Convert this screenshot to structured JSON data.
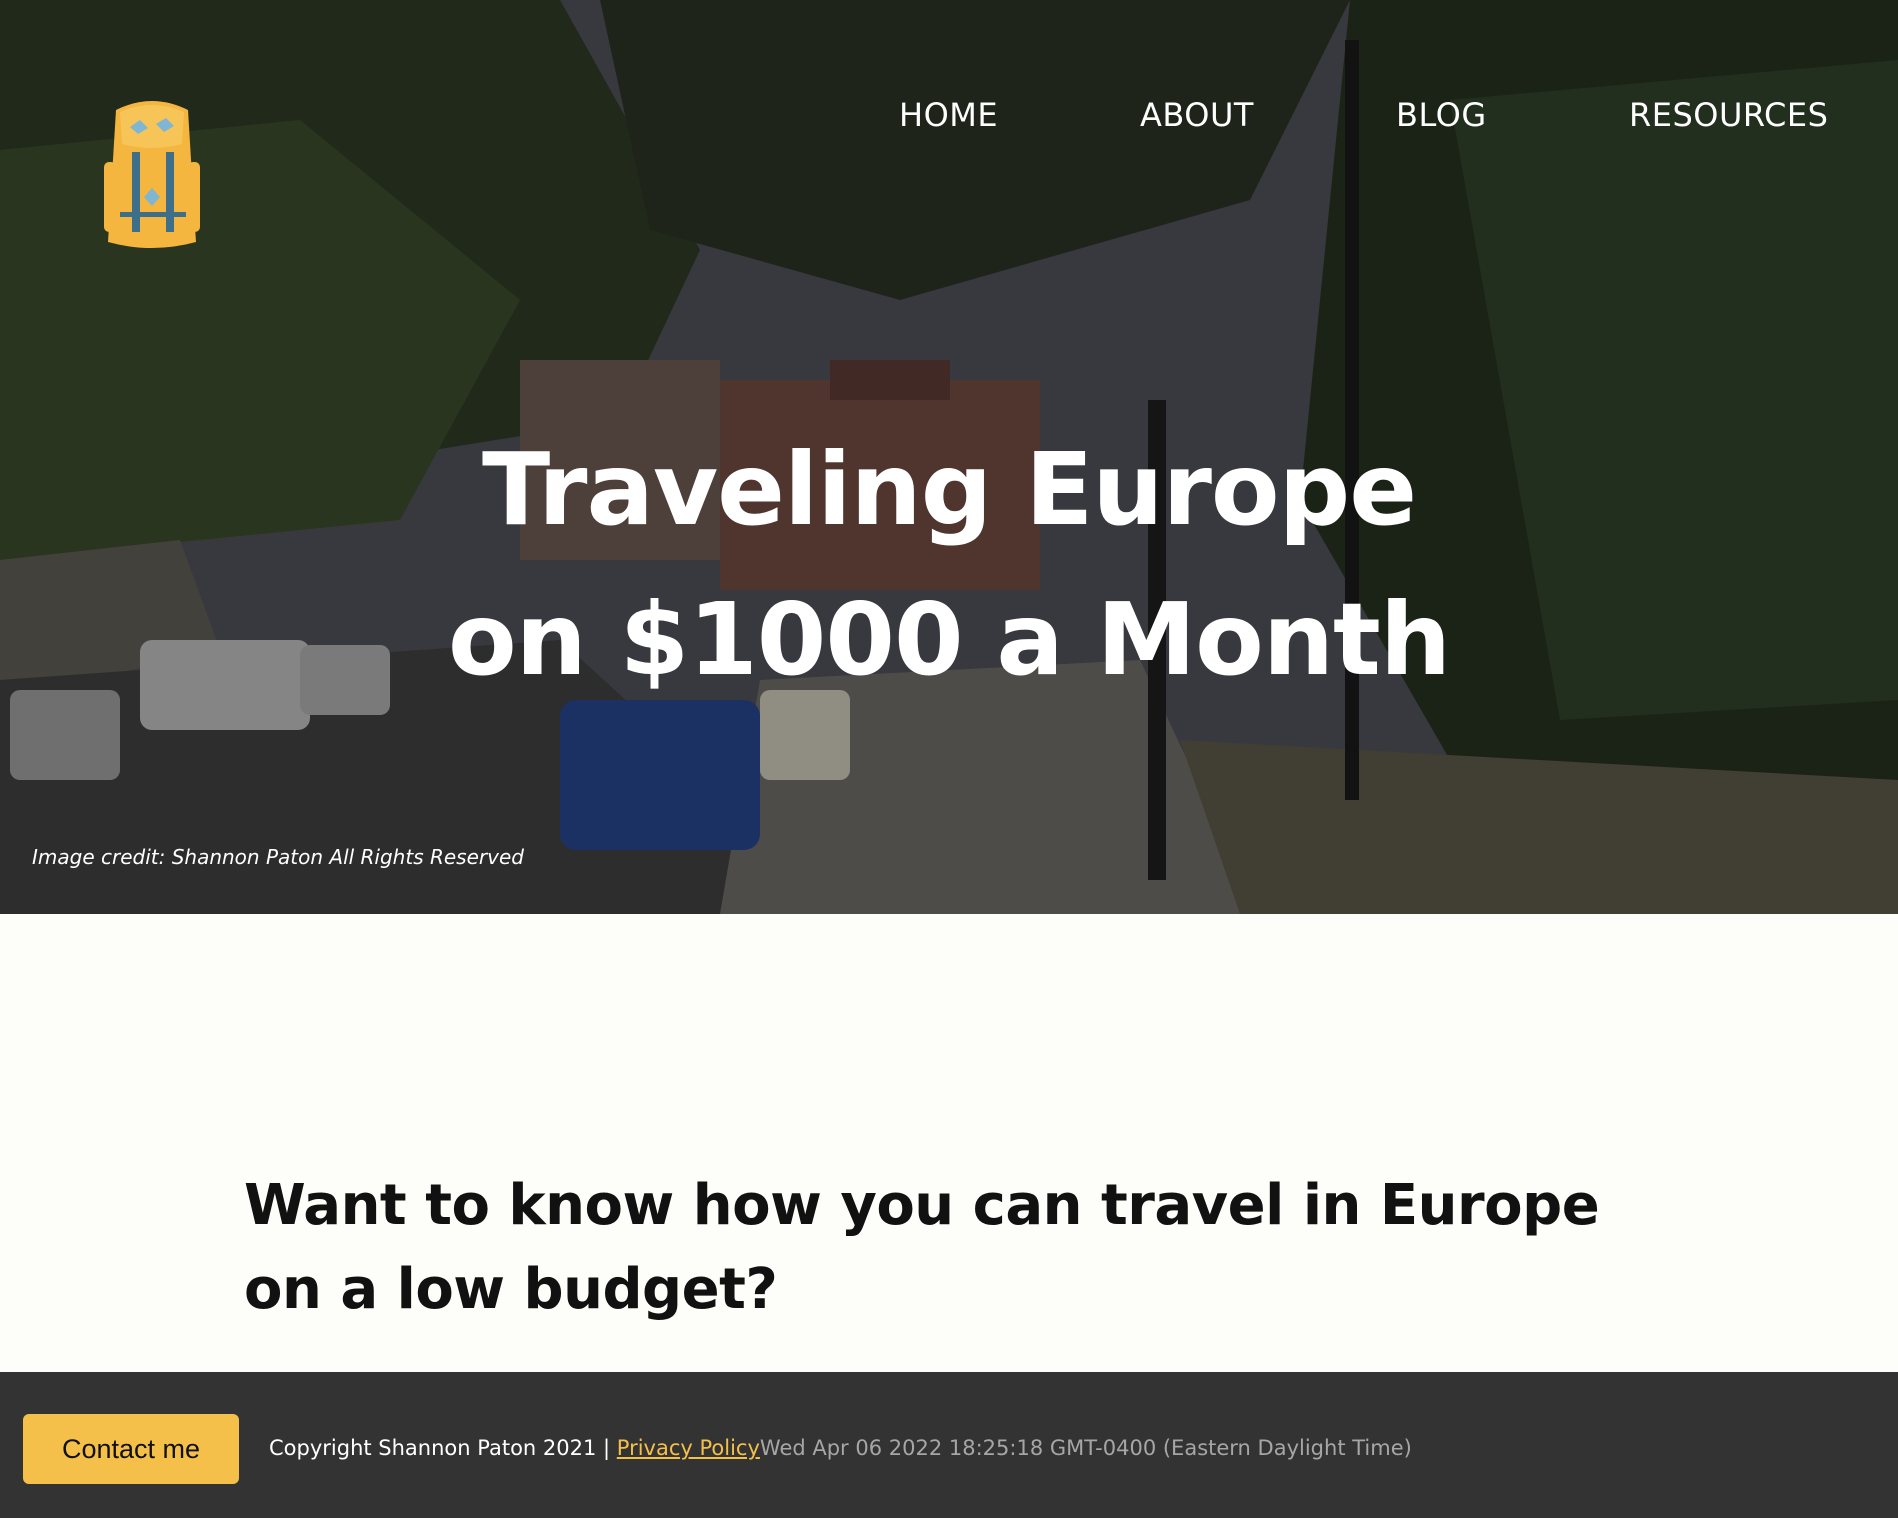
{
  "nav": {
    "home": "HOME",
    "about": "ABOUT",
    "blog": "BLOG",
    "resources": "RESOURCES"
  },
  "logo": {
    "icon": "backpack-icon"
  },
  "hero": {
    "title_line1": "Traveling Europe",
    "title_line2": "on $1000 a Month",
    "credit": "Image credit: Shannon Paton All Rights Reserved"
  },
  "main": {
    "lead": "Want to know how you can travel in Europe on a low budget?"
  },
  "footer": {
    "contact_label": "Contact me",
    "copyright": "Copyright Shannon Paton 2021 | ",
    "privacy_label": "Privacy Policy",
    "date": "Wed Apr 06 2022 18:25:18 GMT-0400 (Eastern Daylight Time)"
  },
  "colors": {
    "accent": "#f4c04a",
    "footer_bg": "#333333",
    "page_bg": "#fdfdf9"
  }
}
